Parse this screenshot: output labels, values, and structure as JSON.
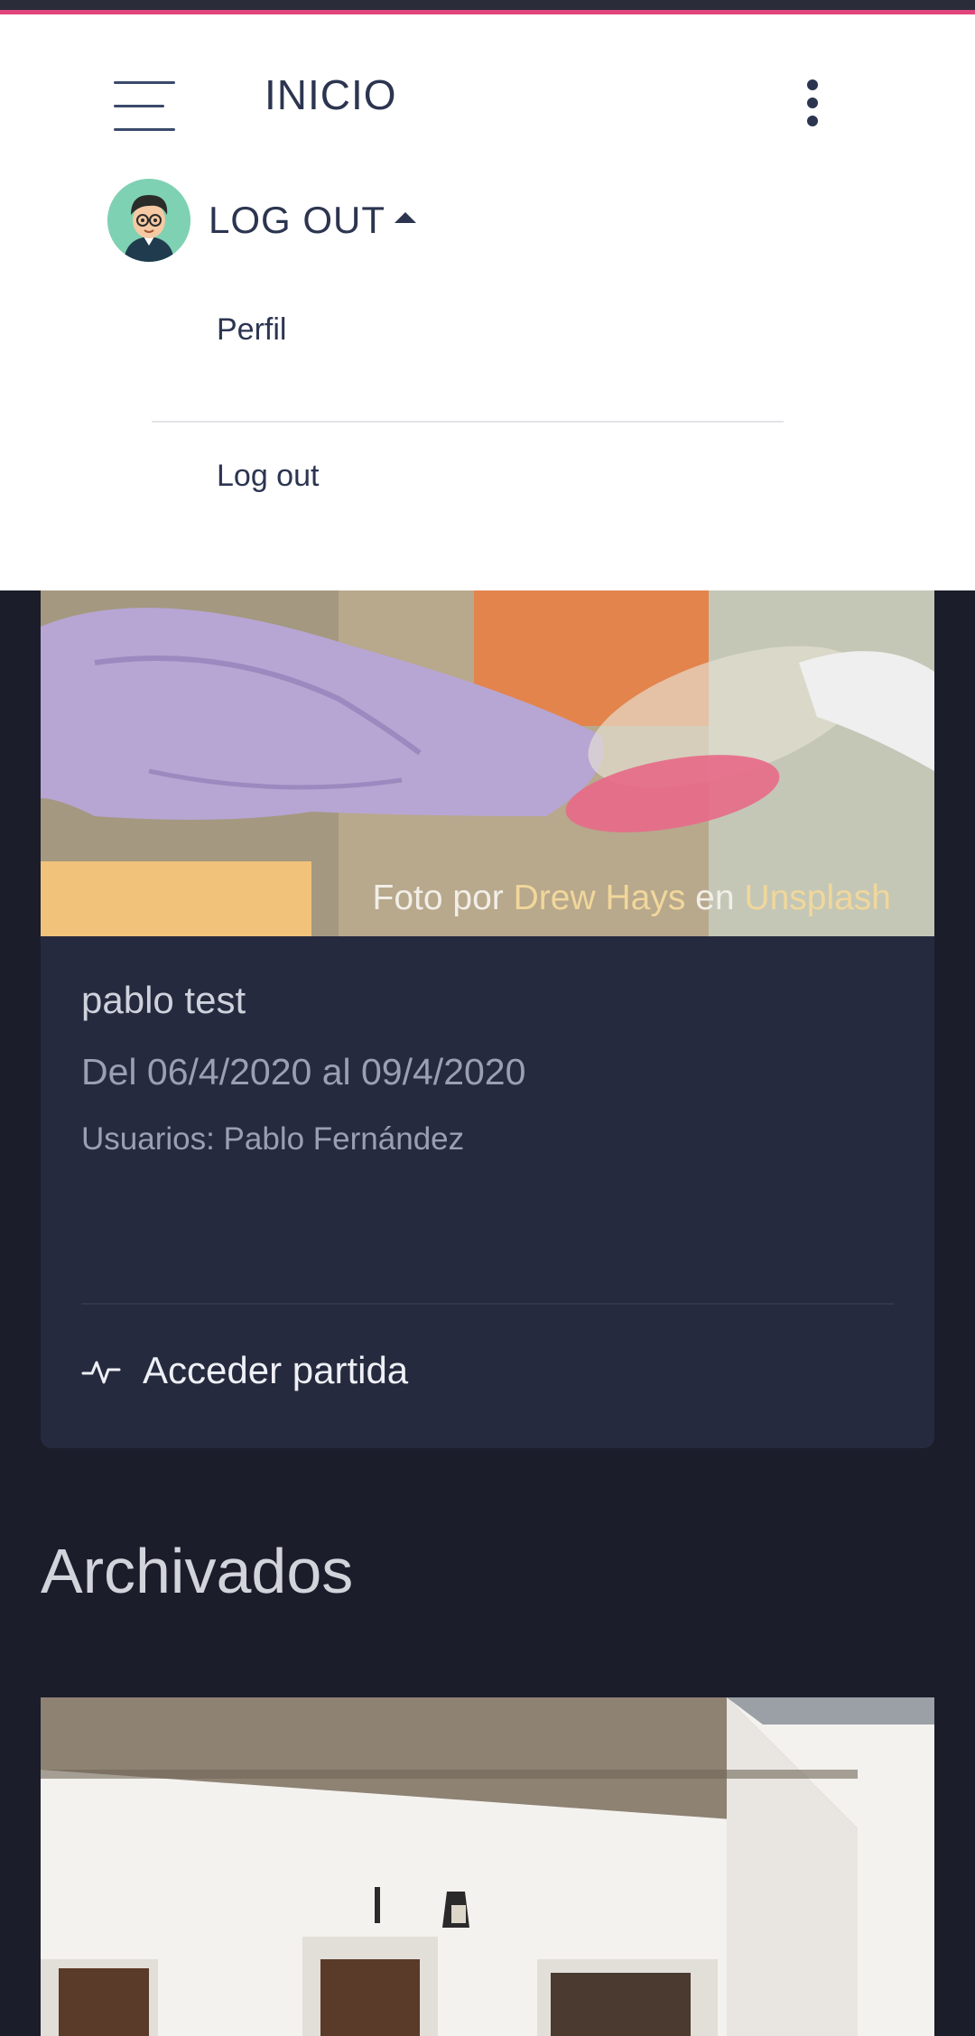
{
  "header": {
    "title": "INICIO",
    "user_menu": {
      "toggle_label": "LOG OUT",
      "items": [
        {
          "label": "Perfil"
        },
        {
          "label": "Log out"
        }
      ]
    }
  },
  "cards": [
    {
      "photo_credit": {
        "prefix": "Foto por",
        "author": "Drew Hays",
        "connector": "en",
        "source": "Unsplash"
      },
      "title": "pablo test",
      "dates": "Del 06/4/2020 al 09/4/2020",
      "users": "Usuarios: Pablo Fernández",
      "action_label": "Acceder partida",
      "action_icon": "activity-icon"
    }
  ],
  "archived": {
    "section_title": "Archivados"
  },
  "colors": {
    "accent": "#e0457b",
    "background": "#1c1d2a",
    "card": "#262a3e",
    "header_text": "#2c3550",
    "credit_link": "#f1d79b"
  }
}
